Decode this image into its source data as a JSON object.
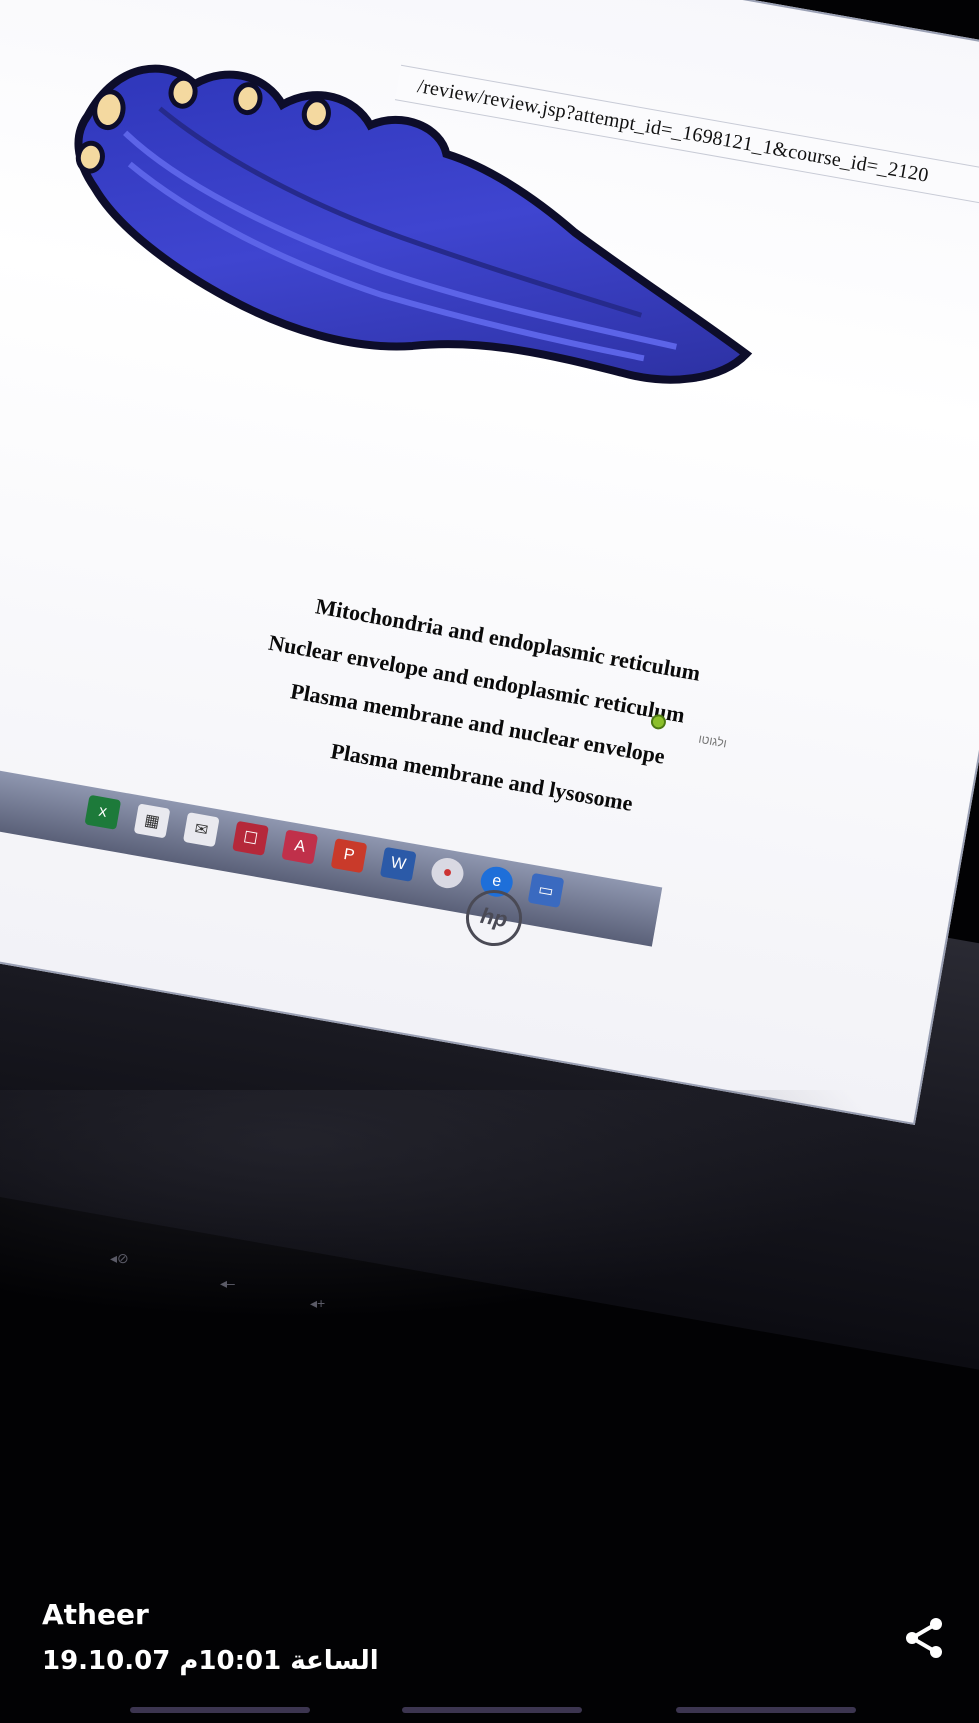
{
  "browser": {
    "url_fragment": "/review/review.jsp?attempt_id=_1698121_1&course_id=_2120"
  },
  "quiz": {
    "answers": [
      {
        "label": "Mitochondria and endoplasmic reticulum"
      },
      {
        "label": "Nuclear envelope and endoplasmic reticulum",
        "marked_correct": true
      },
      {
        "label": "Plasma membrane and nuclear envelope"
      },
      {
        "label": "Plasma membrane and lysosome"
      }
    ],
    "side_label": "ולגוטו"
  },
  "taskbar": {
    "icons": [
      "excel-icon",
      "store-icon",
      "mail-icon",
      "whiteboard-icon",
      "access-icon",
      "powerpoint-icon",
      "word-icon",
      "chrome-icon",
      "edge-icon",
      "folder-icon"
    ]
  },
  "device": {
    "brand": "hp"
  },
  "viewer": {
    "author": "Atheer",
    "datetime": "19.10.07 الساعة 10:01م",
    "share_icon": "share-icon"
  },
  "colors": {
    "figure_blue": "#3a3fc8",
    "correct_marker": "#8bbf2a"
  }
}
